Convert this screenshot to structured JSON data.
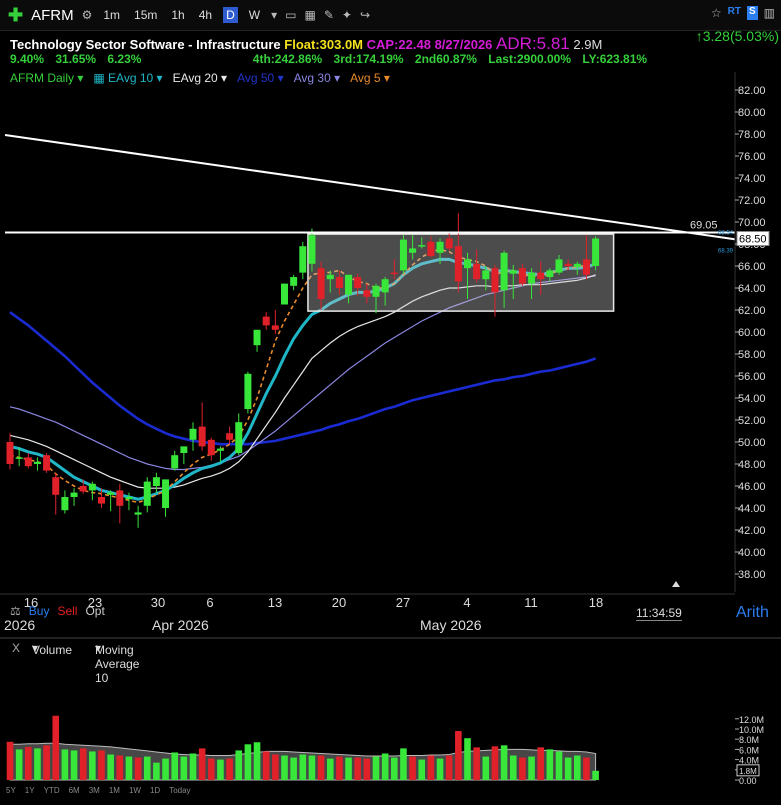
{
  "toolbar": {
    "symbol": "AFRM",
    "timeframes": [
      "1m",
      "15m",
      "1h",
      "4h",
      "D",
      "W"
    ],
    "active_timeframe": "D",
    "right_rt": "RT",
    "right_s": "S"
  },
  "header": {
    "sector": "Technology Sector Software - Infrastructure",
    "float": "Float:303.0M",
    "cap": "CAP:22.48",
    "date": "8/27/2026",
    "adr": "ADR:5.81",
    "avg_vol": "2.9M",
    "change": "↑3.28(5.03%)",
    "perf_a": "9.40%",
    "perf_b": "31.65%",
    "perf_c": "6.23%",
    "q4": "4th:242.86%",
    "q3": "3rd:174.19%",
    "q2": "2nd60.87%",
    "last": "Last:2900.00%",
    "ly": "LY:623.81%"
  },
  "legend": {
    "main": "AFRM Daily",
    "eavg10": "EAvg 10",
    "eavg20": "EAvg 20",
    "avg50": "Avg 50",
    "avg30": "Avg 30",
    "avg5": "Avg 5"
  },
  "bottom": {
    "buy": "Buy",
    "sell": "Sell",
    "opt": "Opt",
    "year_left": "2026",
    "month_apr": "Apr 2026",
    "month_may": "May 2026",
    "clock": "11:34:59",
    "corner": "Arith"
  },
  "volume_bar": {
    "close": "X",
    "label": "Volume",
    "ma_label": "Moving Average 10"
  },
  "periods": [
    "5Y",
    "1Y",
    "YTD",
    "6M",
    "3M",
    "1M",
    "1W",
    "1D",
    "Today"
  ],
  "colors": {
    "up": "#39e63a",
    "down": "#e0212a",
    "ema10": "#1fb7c8",
    "ema20": "#e8e8e8",
    "sma50": "#1a2bd1",
    "sma30": "#8a86e0",
    "sma5": "#e8892b",
    "trend": "#ffffff"
  },
  "chart_data": {
    "type": "candlestick",
    "ylim": [
      37,
      83
    ],
    "y_ticks": [
      "82.00",
      "80.00",
      "78.00",
      "76.00",
      "74.00",
      "72.00",
      "70.00",
      "68.00",
      "66.00",
      "64.00",
      "62.00",
      "60.00",
      "58.00",
      "56.00",
      "54.00",
      "52.00",
      "50.00",
      "48.00",
      "46.00",
      "44.00",
      "42.00",
      "40.00",
      "38.00"
    ],
    "x_ticks": [
      "16",
      "23",
      "30",
      "6",
      "13",
      "20",
      "27",
      "4",
      "11",
      "18"
    ],
    "resistance_value": "69.05",
    "last_price": "68.50",
    "ma_top_value": "68.54",
    "ma_bottom_value": "68.39",
    "candles": [
      {
        "o": 50.0,
        "h": 50.8,
        "l": 47.5,
        "c": 48.0
      },
      {
        "o": 48.5,
        "h": 49.5,
        "l": 47.8,
        "c": 48.6
      },
      {
        "o": 48.6,
        "h": 49.0,
        "l": 47.6,
        "c": 47.8
      },
      {
        "o": 48.0,
        "h": 48.6,
        "l": 47.4,
        "c": 48.2
      },
      {
        "o": 48.8,
        "h": 49.0,
        "l": 47.2,
        "c": 47.4
      },
      {
        "o": 46.8,
        "h": 47.2,
        "l": 43.4,
        "c": 45.2
      },
      {
        "o": 43.8,
        "h": 45.6,
        "l": 43.5,
        "c": 45.0
      },
      {
        "o": 45.0,
        "h": 45.8,
        "l": 44.2,
        "c": 45.4
      },
      {
        "o": 46.0,
        "h": 46.6,
        "l": 45.3,
        "c": 45.5
      },
      {
        "o": 45.6,
        "h": 46.4,
        "l": 44.7,
        "c": 46.2
      },
      {
        "o": 45.0,
        "h": 45.8,
        "l": 44.0,
        "c": 44.4
      },
      {
        "o": 45.2,
        "h": 45.6,
        "l": 43.7,
        "c": 45.4
      },
      {
        "o": 45.6,
        "h": 46.2,
        "l": 42.6,
        "c": 44.2
      },
      {
        "o": 44.8,
        "h": 45.4,
        "l": 43.8,
        "c": 45.0
      },
      {
        "o": 43.4,
        "h": 44.2,
        "l": 42.2,
        "c": 43.6
      },
      {
        "o": 44.2,
        "h": 46.8,
        "l": 43.6,
        "c": 46.4
      },
      {
        "o": 46.0,
        "h": 47.2,
        "l": 45.4,
        "c": 46.8
      },
      {
        "o": 44.0,
        "h": 46.6,
        "l": 43.2,
        "c": 46.6
      },
      {
        "o": 47.6,
        "h": 49.2,
        "l": 47.4,
        "c": 48.8
      },
      {
        "o": 49.0,
        "h": 49.6,
        "l": 48.0,
        "c": 49.6
      },
      {
        "o": 50.2,
        "h": 51.8,
        "l": 49.2,
        "c": 51.2
      },
      {
        "o": 51.4,
        "h": 53.6,
        "l": 49.2,
        "c": 49.6
      },
      {
        "o": 50.2,
        "h": 50.4,
        "l": 48.3,
        "c": 48.8
      },
      {
        "o": 49.2,
        "h": 49.6,
        "l": 48.2,
        "c": 49.4
      },
      {
        "o": 50.8,
        "h": 51.4,
        "l": 49.8,
        "c": 50.2
      },
      {
        "o": 49.0,
        "h": 52.6,
        "l": 48.8,
        "c": 51.8
      },
      {
        "o": 53.0,
        "h": 56.4,
        "l": 52.6,
        "c": 56.2
      },
      {
        "o": 58.8,
        "h": 60.2,
        "l": 58.2,
        "c": 60.2
      },
      {
        "o": 61.4,
        "h": 61.8,
        "l": 60.2,
        "c": 60.6
      },
      {
        "o": 60.6,
        "h": 62.0,
        "l": 59.8,
        "c": 60.2
      },
      {
        "o": 62.5,
        "h": 64.4,
        "l": 62.5,
        "c": 64.4
      },
      {
        "o": 64.2,
        "h": 65.2,
        "l": 63.8,
        "c": 65.0
      },
      {
        "o": 65.4,
        "h": 68.2,
        "l": 64.8,
        "c": 67.8
      },
      {
        "o": 66.2,
        "h": 69.4,
        "l": 65.5,
        "c": 68.8
      },
      {
        "o": 65.8,
        "h": 66.4,
        "l": 62.0,
        "c": 63.0
      },
      {
        "o": 64.8,
        "h": 65.6,
        "l": 63.6,
        "c": 65.2
      },
      {
        "o": 65.0,
        "h": 65.6,
        "l": 63.4,
        "c": 64.0
      },
      {
        "o": 63.4,
        "h": 65.2,
        "l": 62.6,
        "c": 65.2
      },
      {
        "o": 65.0,
        "h": 65.3,
        "l": 63.3,
        "c": 64.0
      },
      {
        "o": 63.8,
        "h": 64.4,
        "l": 62.6,
        "c": 63.2
      },
      {
        "o": 63.2,
        "h": 64.4,
        "l": 61.7,
        "c": 64.2
      },
      {
        "o": 63.6,
        "h": 65.0,
        "l": 62.4,
        "c": 64.8
      },
      {
        "o": 65.4,
        "h": 66.6,
        "l": 64.8,
        "c": 65.3
      },
      {
        "o": 65.6,
        "h": 68.8,
        "l": 65.3,
        "c": 68.4
      },
      {
        "o": 67.2,
        "h": 68.8,
        "l": 66.6,
        "c": 67.6
      },
      {
        "o": 67.8,
        "h": 68.6,
        "l": 67.6,
        "c": 67.9
      },
      {
        "o": 68.2,
        "h": 68.7,
        "l": 66.8,
        "c": 66.9
      },
      {
        "o": 67.2,
        "h": 68.5,
        "l": 66.2,
        "c": 68.2
      },
      {
        "o": 68.5,
        "h": 69.0,
        "l": 67.4,
        "c": 67.6
      },
      {
        "o": 67.8,
        "h": 70.8,
        "l": 63.6,
        "c": 64.6
      },
      {
        "o": 65.8,
        "h": 67.2,
        "l": 63.0,
        "c": 66.6
      },
      {
        "o": 66.2,
        "h": 67.5,
        "l": 64.5,
        "c": 64.8
      },
      {
        "o": 64.8,
        "h": 66.0,
        "l": 63.8,
        "c": 65.6
      },
      {
        "o": 65.8,
        "h": 66.1,
        "l": 61.4,
        "c": 63.6
      },
      {
        "o": 63.8,
        "h": 67.4,
        "l": 62.2,
        "c": 67.2
      },
      {
        "o": 65.3,
        "h": 66.1,
        "l": 63.0,
        "c": 65.6
      },
      {
        "o": 65.8,
        "h": 66.2,
        "l": 64.2,
        "c": 64.4
      },
      {
        "o": 64.4,
        "h": 65.8,
        "l": 63.0,
        "c": 65.4
      },
      {
        "o": 65.4,
        "h": 66.4,
        "l": 63.4,
        "c": 64.8
      },
      {
        "o": 65.0,
        "h": 65.8,
        "l": 64.6,
        "c": 65.6
      },
      {
        "o": 65.4,
        "h": 67.0,
        "l": 65.2,
        "c": 66.6
      },
      {
        "o": 66.2,
        "h": 66.6,
        "l": 65.6,
        "c": 66.0
      },
      {
        "o": 65.9,
        "h": 66.4,
        "l": 65.2,
        "c": 66.2
      },
      {
        "o": 66.6,
        "h": 68.8,
        "l": 64.8,
        "c": 65.2
      },
      {
        "o": 66.0,
        "h": 68.7,
        "l": 65.6,
        "c": 68.5
      }
    ],
    "ema10": [
      49.6,
      49.4,
      49.1,
      48.9,
      48.6,
      48.0,
      47.4,
      46.8,
      46.4,
      46.0,
      45.6,
      45.4,
      45.2,
      45.0,
      44.8,
      45.0,
      45.3,
      45.6,
      46.1,
      46.7,
      47.2,
      47.6,
      47.8,
      48.1,
      48.6,
      49.4,
      50.8,
      52.6,
      54.4,
      56.0,
      57.8,
      59.4,
      60.6,
      61.6,
      62.0,
      62.6,
      63.0,
      63.4,
      63.6,
      63.6,
      63.7,
      64.0,
      64.4,
      65.2,
      65.8,
      66.2,
      66.4,
      66.6,
      66.6,
      66.3,
      66.2,
      66.0,
      65.8,
      65.5,
      65.6,
      65.5,
      65.4,
      65.3,
      65.2,
      65.4,
      65.6,
      65.8,
      65.8,
      65.9,
      66.2
    ],
    "ema20": [
      50.6,
      50.4,
      50.2,
      49.9,
      49.6,
      49.2,
      48.8,
      48.4,
      48.0,
      47.6,
      47.2,
      46.8,
      46.5,
      46.2,
      45.9,
      45.8,
      45.8,
      45.8,
      45.9,
      46.1,
      46.4,
      46.7,
      46.9,
      47.2,
      47.6,
      48.2,
      49.1,
      50.3,
      51.5,
      52.7,
      54.0,
      55.2,
      56.4,
      57.6,
      58.3,
      59.0,
      59.6,
      60.1,
      60.5,
      60.8,
      61.1,
      61.4,
      61.8,
      62.3,
      62.8,
      63.2,
      63.5,
      63.8,
      64.0,
      64.0,
      64.1,
      64.2,
      64.2,
      64.1,
      64.2,
      64.2,
      64.3,
      64.3,
      64.3,
      64.4,
      64.5,
      64.6,
      64.7,
      64.9,
      65.2
    ],
    "sma30": [
      53.2,
      53.0,
      52.7,
      52.4,
      52.1,
      51.8,
      51.4,
      51.0,
      50.6,
      50.2,
      49.8,
      49.4,
      49.0,
      48.6,
      48.3,
      48.0,
      47.8,
      47.6,
      47.5,
      47.5,
      47.6,
      47.7,
      47.9,
      48.1,
      48.4,
      48.7,
      49.2,
      49.8,
      50.4,
      51.0,
      51.7,
      52.4,
      53.1,
      53.8,
      54.5,
      55.2,
      55.9,
      56.6,
      57.2,
      57.8,
      58.4,
      59.0,
      59.5,
      60.0,
      60.5,
      61.0,
      61.4,
      61.8,
      62.2,
      62.5,
      62.8,
      63.1,
      63.4,
      63.6,
      63.8,
      64.0,
      64.2,
      64.4,
      64.5,
      64.6,
      64.7,
      64.8,
      64.9,
      65.0,
      65.1
    ],
    "sma50": [
      61.8,
      61.2,
      60.6,
      59.9,
      59.2,
      58.5,
      57.8,
      57.0,
      56.2,
      55.4,
      54.7,
      54.0,
      53.3,
      52.7,
      52.1,
      51.6,
      51.2,
      50.8,
      50.5,
      50.3,
      50.1,
      50.0,
      49.9,
      49.8,
      49.8,
      49.8,
      49.8,
      49.9,
      50.0,
      50.1,
      50.3,
      50.5,
      50.7,
      50.9,
      51.1,
      51.4,
      51.6,
      51.9,
      52.1,
      52.4,
      52.7,
      53.0,
      53.2,
      53.5,
      53.8,
      54.0,
      54.2,
      54.4,
      54.6,
      54.8,
      55.0,
      55.2,
      55.4,
      55.6,
      55.7,
      55.9,
      56.0,
      56.2,
      56.4,
      56.5,
      56.7,
      56.9,
      57.1,
      57.3,
      57.6
    ],
    "sma5": [
      48.8,
      48.6,
      48.4,
      48.2,
      47.9,
      47.1,
      46.5,
      46.0,
      45.6,
      45.4,
      45.3,
      45.1,
      44.9,
      44.7,
      44.5,
      44.8,
      45.2,
      45.6,
      46.4,
      47.2,
      48.0,
      48.6,
      48.9,
      49.3,
      49.8,
      50.5,
      52.0,
      54.0,
      56.6,
      59.2,
      61.0,
      62.5,
      64.0,
      65.2,
      65.4,
      65.4,
      65.6,
      65.0,
      64.6,
      64.4,
      64.0,
      64.0,
      64.4,
      65.2,
      66.1,
      66.8,
      67.3,
      67.5,
      67.3,
      66.8,
      66.6,
      66.4,
      66.0,
      65.2,
      65.5,
      65.6,
      65.2,
      65.1,
      65.0,
      65.3,
      65.6,
      65.8,
      65.9,
      66.1,
      66.6
    ],
    "volume": [
      {
        "v": 7.5,
        "up": false
      },
      {
        "v": 6.0,
        "up": true
      },
      {
        "v": 6.5,
        "up": false
      },
      {
        "v": 6.2,
        "up": true
      },
      {
        "v": 6.8,
        "up": false
      },
      {
        "v": 12.6,
        "up": false
      },
      {
        "v": 6.0,
        "up": true
      },
      {
        "v": 5.8,
        "up": true
      },
      {
        "v": 6.2,
        "up": false
      },
      {
        "v": 5.6,
        "up": true
      },
      {
        "v": 5.8,
        "up": false
      },
      {
        "v": 5.0,
        "up": true
      },
      {
        "v": 4.8,
        "up": false
      },
      {
        "v": 4.6,
        "up": true
      },
      {
        "v": 4.4,
        "up": false
      },
      {
        "v": 4.6,
        "up": true
      },
      {
        "v": 3.4,
        "up": true
      },
      {
        "v": 4.2,
        "up": true
      },
      {
        "v": 5.4,
        "up": true
      },
      {
        "v": 4.6,
        "up": true
      },
      {
        "v": 5.2,
        "up": true
      },
      {
        "v": 6.2,
        "up": false
      },
      {
        "v": 4.2,
        "up": false
      },
      {
        "v": 4.0,
        "up": true
      },
      {
        "v": 4.2,
        "up": false
      },
      {
        "v": 5.8,
        "up": true
      },
      {
        "v": 7.0,
        "up": true
      },
      {
        "v": 7.4,
        "up": true
      },
      {
        "v": 5.6,
        "up": false
      },
      {
        "v": 5.0,
        "up": false
      },
      {
        "v": 4.8,
        "up": true
      },
      {
        "v": 4.4,
        "up": true
      },
      {
        "v": 5.0,
        "up": true
      },
      {
        "v": 4.8,
        "up": true
      },
      {
        "v": 4.8,
        "up": false
      },
      {
        "v": 4.2,
        "up": true
      },
      {
        "v": 4.6,
        "up": false
      },
      {
        "v": 4.4,
        "up": true
      },
      {
        "v": 4.4,
        "up": false
      },
      {
        "v": 4.2,
        "up": false
      },
      {
        "v": 4.6,
        "up": true
      },
      {
        "v": 5.2,
        "up": true
      },
      {
        "v": 4.4,
        "up": true
      },
      {
        "v": 6.2,
        "up": true
      },
      {
        "v": 4.6,
        "up": false
      },
      {
        "v": 4.0,
        "up": true
      },
      {
        "v": 4.8,
        "up": false
      },
      {
        "v": 4.2,
        "up": true
      },
      {
        "v": 4.8,
        "up": false
      },
      {
        "v": 9.6,
        "up": false
      },
      {
        "v": 8.2,
        "up": true
      },
      {
        "v": 6.4,
        "up": false
      },
      {
        "v": 4.6,
        "up": true
      },
      {
        "v": 6.6,
        "up": false
      },
      {
        "v": 6.8,
        "up": true
      },
      {
        "v": 4.8,
        "up": true
      },
      {
        "v": 4.4,
        "up": false
      },
      {
        "v": 4.6,
        "up": true
      },
      {
        "v": 6.4,
        "up": false
      },
      {
        "v": 6.0,
        "up": true
      },
      {
        "v": 5.6,
        "up": true
      },
      {
        "v": 4.4,
        "up": true
      },
      {
        "v": 4.8,
        "up": true
      },
      {
        "v": 4.4,
        "up": false
      },
      {
        "v": 1.8,
        "up": true
      }
    ],
    "volume_ma": [
      7.0,
      7.0,
      7.1,
      7.1,
      7.2,
      7.2,
      7.0,
      6.9,
      6.8,
      6.7,
      6.6,
      6.5,
      6.3,
      6.1,
      5.9,
      5.7,
      5.5,
      5.3,
      5.1,
      5.0,
      4.9,
      4.9,
      4.8,
      4.8,
      4.8,
      5.0,
      5.2,
      5.4,
      5.6,
      5.6,
      5.6,
      5.5,
      5.4,
      5.3,
      5.2,
      5.1,
      5.0,
      4.9,
      4.8,
      4.7,
      4.7,
      4.7,
      4.7,
      4.8,
      4.8,
      4.8,
      4.9,
      4.9,
      5.0,
      5.4,
      5.6,
      5.7,
      5.8,
      5.9,
      6.0,
      6.0,
      6.0,
      5.9,
      5.8,
      5.8,
      5.7,
      5.6,
      5.6,
      5.5,
      5.2
    ],
    "volume_ylim": [
      0,
      13.5
    ],
    "volume_ticks": [
      "12.0M",
      "10.0M",
      "8.0M",
      "6.0M",
      "4.0M",
      "2.0M",
      "0.00"
    ],
    "volume_last": "1.8M"
  }
}
